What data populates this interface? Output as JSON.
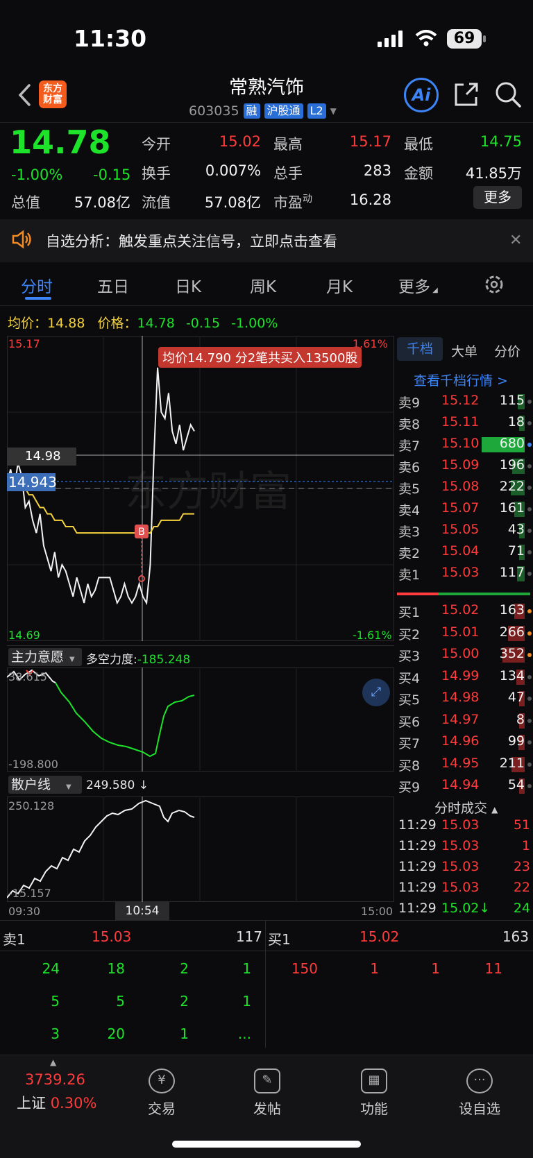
{
  "status_bar": {
    "time": "11:30",
    "battery": "69"
  },
  "header": {
    "logo_text": "东方财富",
    "stock_name": "常熟汽饰",
    "code": "603035",
    "tags": [
      "融",
      "沪股通",
      "L2"
    ],
    "ai_label": "Ai"
  },
  "quote": {
    "last_price": "14.78",
    "change_pct": "-1.00%",
    "change": "-0.15",
    "open_label": "今开",
    "open": "15.02",
    "high_label": "最高",
    "high": "15.17",
    "low_label": "最低",
    "low": "14.75",
    "turnover_label": "换手",
    "turnover": "0.007%",
    "volume_label": "总手",
    "volume": "283",
    "amount_label": "金额",
    "amount": "41.85万",
    "mktcap_label": "总值",
    "mktcap": "57.08亿",
    "float_label": "流值",
    "float_cap": "57.08亿",
    "pe_label": "市盈",
    "pe_sup": "动",
    "pe": "16.28",
    "more_label": "更多"
  },
  "notice": {
    "text": "自选分析：触发重点关注信号，立即点击查看"
  },
  "tabs": {
    "items": [
      "分时",
      "五日",
      "日K",
      "周K",
      "月K",
      "更多"
    ],
    "active": "分时"
  },
  "price_line": {
    "avg_label": "均价：",
    "avg": "14.88",
    "price_label": "价格：",
    "price": "14.78",
    "chg": "-0.15",
    "pct": "-1.00%"
  },
  "chart": {
    "y_top": "15.17",
    "y_bottom": "14.69",
    "pct_top": "1.61%",
    "pct_bottom": "-1.61%",
    "tooltip": "均价14.790  分2笔共买入13500股",
    "cross_price": "14.98",
    "ref_price": "14.943",
    "marker": "B",
    "watermark": "东方财富",
    "indicator1_name": "主力意愿",
    "indicator1_label": "多空力度:",
    "indicator1_value": "-185.248",
    "ind1_top": "38.615",
    "ind1_bottom": "-198.800",
    "indicator2_name": "散户线",
    "indicator2_value": "249.580",
    "ind2_top": "250.128",
    "ind2_bottom": "-15.157",
    "x_start": "09:30",
    "x_cursor": "10:54",
    "x_end": "15:00"
  },
  "chart_data": {
    "type": "line",
    "title": "",
    "ylim": [
      14.69,
      15.17
    ],
    "xlabel": "",
    "ylabel": "",
    "x_range": [
      "09:30",
      "15:00"
    ],
    "series": [
      {
        "values": [
          14.94,
          14.96,
          14.93,
          14.97,
          14.95,
          14.9,
          14.91,
          14.88,
          14.86,
          14.89,
          14.84,
          14.82,
          14.8,
          14.83,
          14.79,
          14.81,
          14.8,
          14.78,
          14.76,
          14.79,
          14.77,
          14.75,
          14.78,
          14.76,
          14.77,
          14.79,
          14.79,
          14.79,
          14.79,
          14.77,
          14.75,
          14.76,
          14.78,
          14.76,
          14.75,
          14.76,
          14.78,
          14.76,
          14.75,
          14.81,
          14.98,
          15.12,
          15.05,
          15.04,
          15.08,
          15.02,
          15.0,
          15.03,
          14.99,
          15.01,
          15.03,
          15.02
        ]
      },
      {
        "values": [
          14.95,
          14.95,
          14.94,
          14.94,
          14.93,
          14.93,
          14.92,
          14.92,
          14.91,
          14.9,
          14.9,
          14.89,
          14.89,
          14.88,
          14.88,
          14.88,
          14.87,
          14.87,
          14.87,
          14.86,
          14.86,
          14.86,
          14.86,
          14.86,
          14.86,
          14.86,
          14.86,
          14.86,
          14.86,
          14.86,
          14.86,
          14.86,
          14.86,
          14.86,
          14.86,
          14.86,
          14.86,
          14.86,
          14.86,
          14.86,
          14.87,
          14.87,
          14.88,
          14.88,
          14.88,
          14.88,
          14.88,
          14.88,
          14.89,
          14.89,
          14.89,
          14.89
        ]
      }
    ]
  },
  "order_book": {
    "tabs": [
      "千档",
      "大单",
      "分价"
    ],
    "link": "查看千档行情 >",
    "asks": [
      {
        "name": "卖9",
        "price": "15.12",
        "vol": "115"
      },
      {
        "name": "卖8",
        "price": "15.11",
        "vol": "18"
      },
      {
        "name": "卖7",
        "price": "15.10",
        "vol": "680"
      },
      {
        "name": "卖6",
        "price": "15.09",
        "vol": "196"
      },
      {
        "name": "卖5",
        "price": "15.08",
        "vol": "222"
      },
      {
        "name": "卖4",
        "price": "15.07",
        "vol": "161"
      },
      {
        "name": "卖3",
        "price": "15.05",
        "vol": "43"
      },
      {
        "name": "卖2",
        "price": "15.04",
        "vol": "71"
      },
      {
        "name": "卖1",
        "price": "15.03",
        "vol": "117"
      }
    ],
    "bids": [
      {
        "name": "买1",
        "price": "15.02",
        "vol": "163"
      },
      {
        "name": "买2",
        "price": "15.01",
        "vol": "266"
      },
      {
        "name": "买3",
        "price": "15.00",
        "vol": "352"
      },
      {
        "name": "买4",
        "price": "14.99",
        "vol": "134"
      },
      {
        "name": "买5",
        "price": "14.98",
        "vol": "47"
      },
      {
        "name": "买6",
        "price": "14.97",
        "vol": "8"
      },
      {
        "name": "买7",
        "price": "14.96",
        "vol": "99"
      },
      {
        "name": "买8",
        "price": "14.95",
        "vol": "211"
      },
      {
        "name": "买9",
        "price": "14.94",
        "vol": "54"
      }
    ],
    "trades_title": "分时成交",
    "trades": [
      {
        "time": "11:29",
        "price": "15.03",
        "vol": "51"
      },
      {
        "time": "11:29",
        "price": "15.03",
        "vol": "1"
      },
      {
        "time": "11:29",
        "price": "15.03",
        "vol": "23"
      },
      {
        "time": "11:29",
        "price": "15.03",
        "vol": "22"
      },
      {
        "time": "11:29",
        "price": "15.02↓",
        "vol": "24"
      }
    ]
  },
  "queue": {
    "sell_label": "卖1",
    "sell_price": "15.03",
    "sell_total": "117",
    "buy_label": "买1",
    "buy_price": "15.02",
    "buy_total": "163",
    "sell_rows": [
      [
        "24",
        "18",
        "2",
        "1"
      ],
      [
        "5",
        "5",
        "2",
        "1"
      ],
      [
        "3",
        "20",
        "1",
        "..."
      ]
    ],
    "buy_rows": [
      [
        "150",
        "1",
        "1",
        "11"
      ]
    ]
  },
  "bottom_nav": {
    "index_value": "3739.26",
    "index_name": "上证",
    "index_pct": "0.30%",
    "items": [
      "交易",
      "发帖",
      "功能",
      "设自选"
    ]
  },
  "colors": {
    "up": "#ff3b3b",
    "down": "#1ee32b",
    "avg": "#f4d23d",
    "accent": "#3d84f7"
  }
}
